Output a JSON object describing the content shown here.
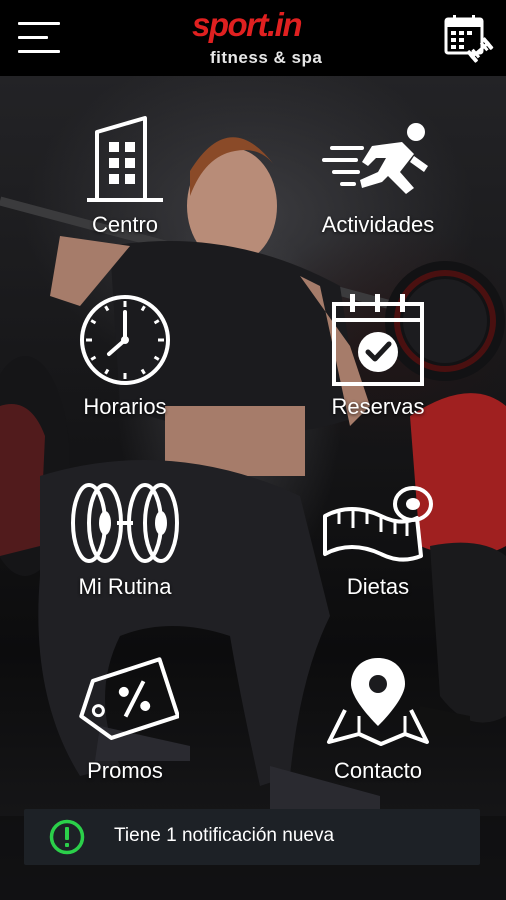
{
  "header": {
    "logo_main": "sport.in",
    "logo_sub": "fitness & spa",
    "menu_icon": "hamburger-menu-icon",
    "calendar_icon": "calendar-dumbbell-icon"
  },
  "tiles": [
    {
      "label": "Centro",
      "icon": "building-icon"
    },
    {
      "label": "Actividades",
      "icon": "running-person-icon"
    },
    {
      "label": "Horarios",
      "icon": "clock-icon"
    },
    {
      "label": "Reservas",
      "icon": "calendar-check-icon"
    },
    {
      "label": "Mi Rutina",
      "icon": "weight-plates-icon"
    },
    {
      "label": "Dietas",
      "icon": "measuring-tape-icon"
    },
    {
      "label": "Promos",
      "icon": "discount-tag-icon"
    },
    {
      "label": "Contacto",
      "icon": "map-pin-icon"
    }
  ],
  "notification": {
    "icon": "alert-circle-icon",
    "text": "Tiene 1 notificación nueva"
  },
  "colors": {
    "brand_red": "#e02020",
    "alert_green": "#2bd04a",
    "toast_bg": "#1d2126"
  }
}
